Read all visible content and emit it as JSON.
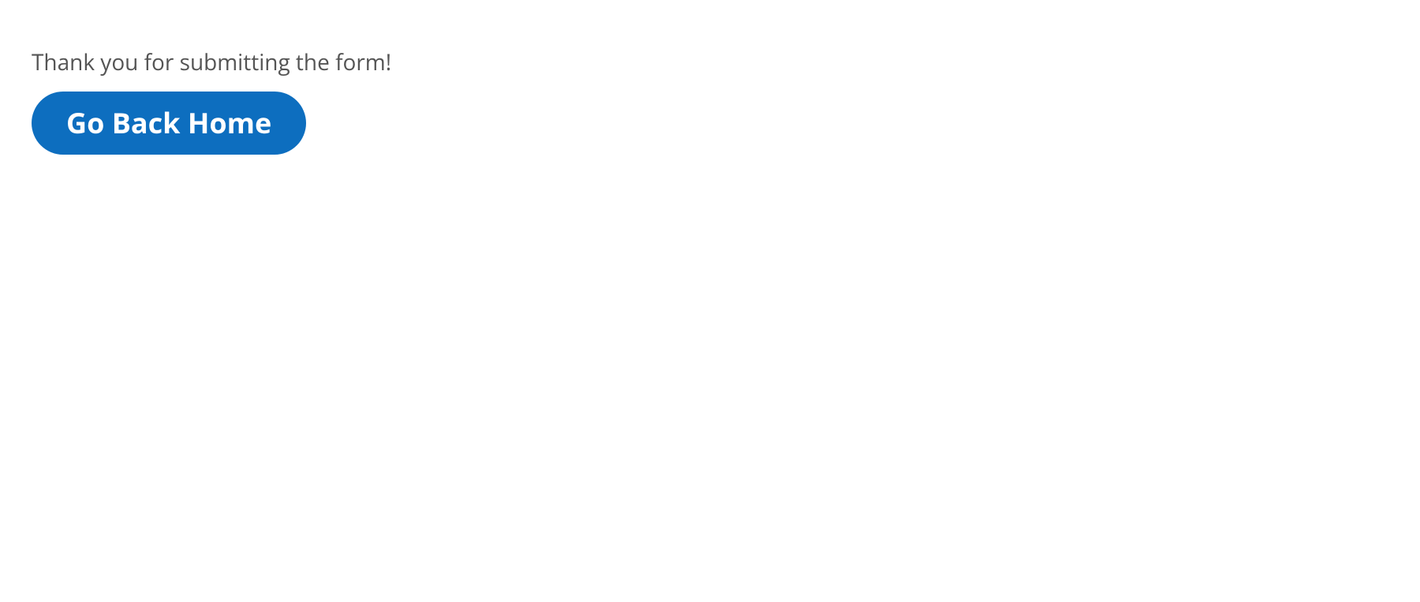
{
  "message": "Thank you for submitting the form!",
  "button_label": "Go Back Home"
}
